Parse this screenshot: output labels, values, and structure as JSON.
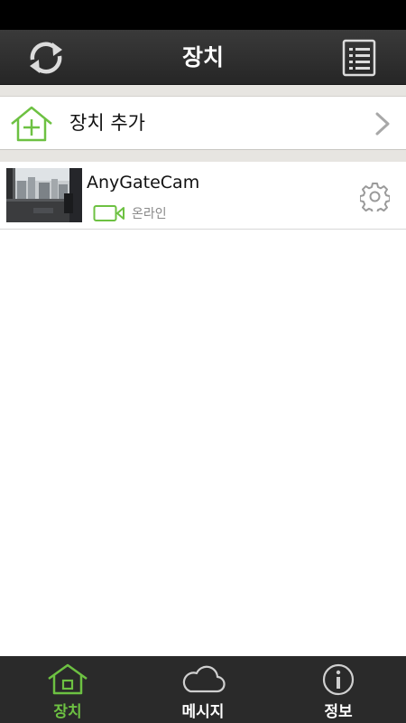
{
  "header": {
    "title": "장치",
    "refresh_icon": "refresh-icon",
    "list_icon": "list-icon"
  },
  "add_device": {
    "label": "장치 추가",
    "icon": "home-add-icon",
    "chevron_icon": "chevron-right-icon"
  },
  "devices": [
    {
      "name": "AnyGateCam",
      "status": "온라인",
      "status_icon": "video-camera-icon",
      "settings_icon": "gear-icon",
      "thumbnail": "camera-snapshot"
    }
  ],
  "tabs": [
    {
      "label": "장치",
      "icon": "home-icon",
      "active": true
    },
    {
      "label": "메시지",
      "icon": "cloud-icon",
      "active": false
    },
    {
      "label": "정보",
      "icon": "info-icon",
      "active": false
    }
  ],
  "colors": {
    "accent": "#6dc142",
    "header_bg": "#2f2f2f",
    "tab_bar_bg": "#2a2a2a",
    "separator": "#e7e5e1",
    "status_text": "#8a8a8a"
  }
}
